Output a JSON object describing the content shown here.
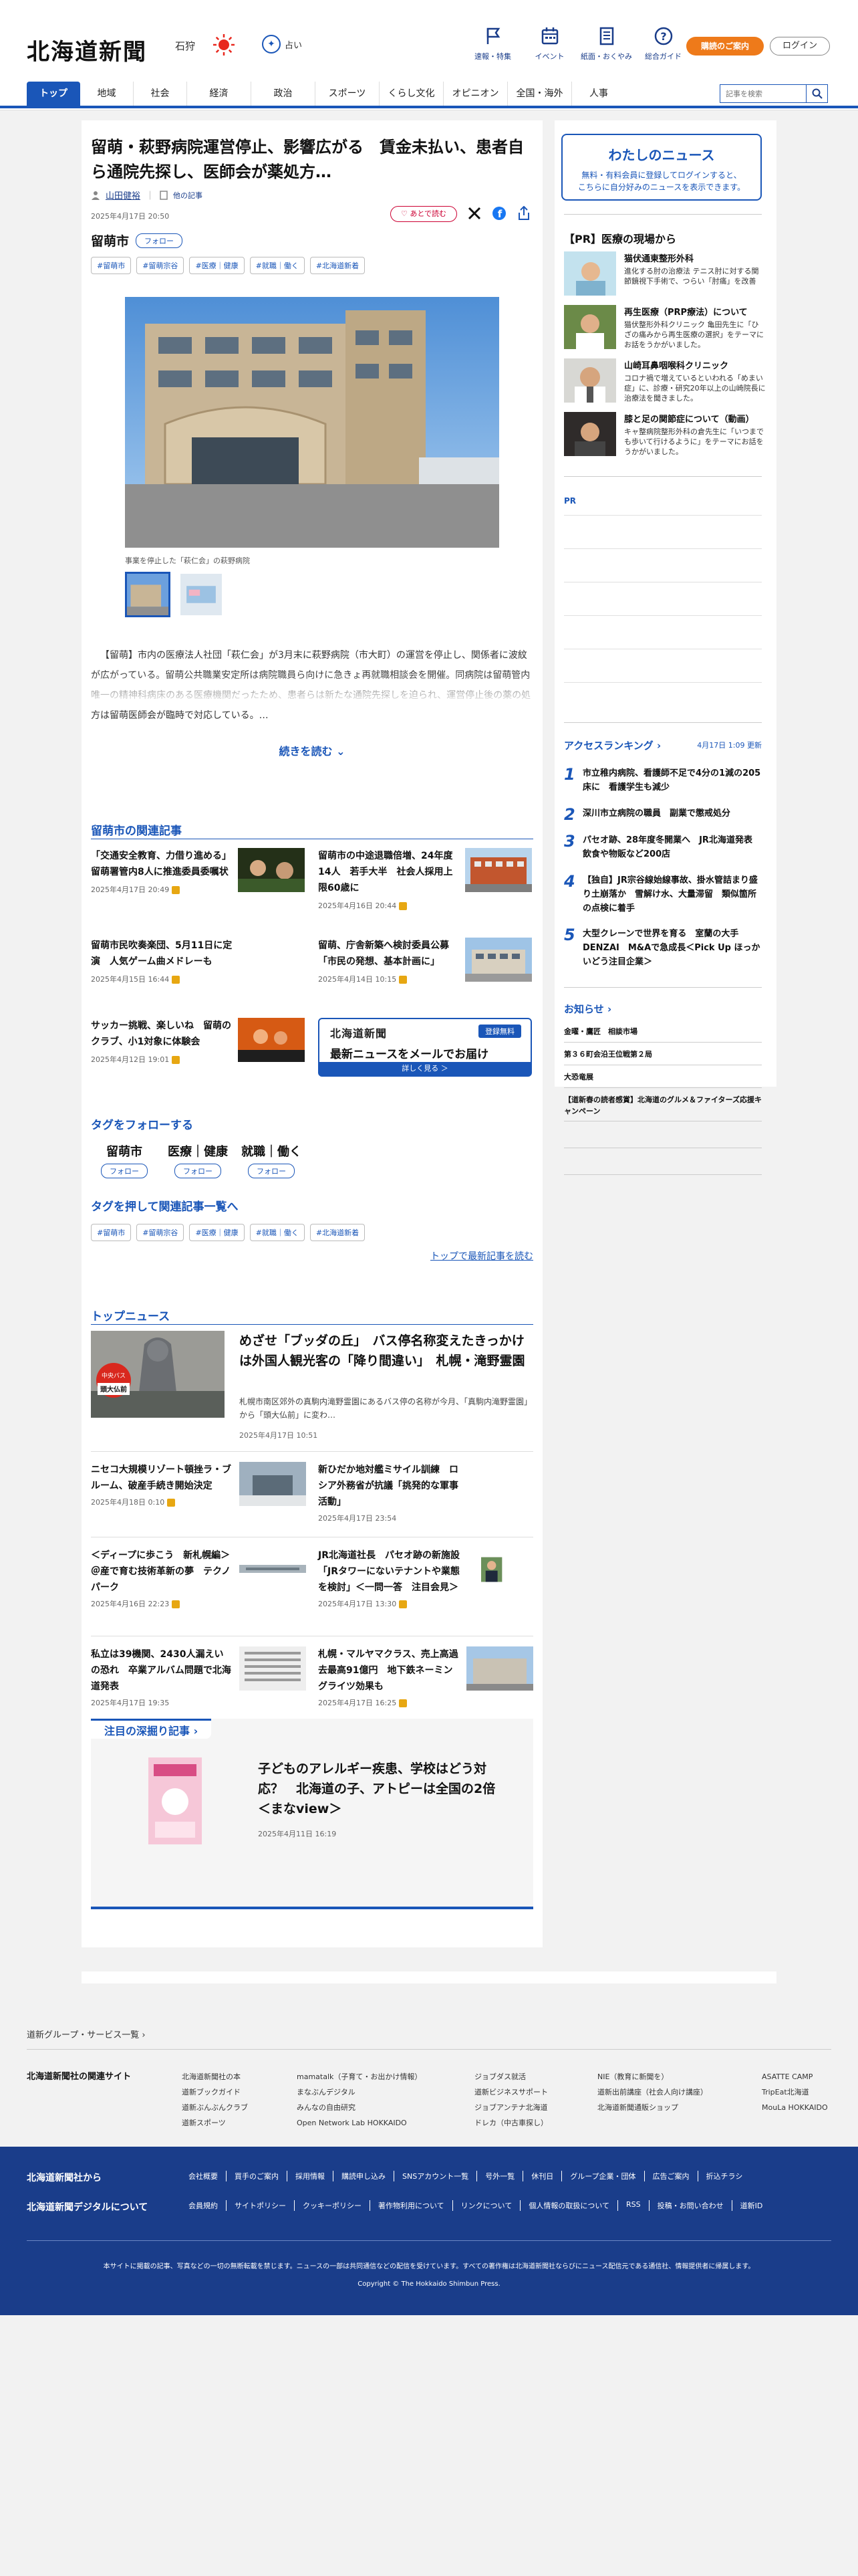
{
  "header": {
    "logo": "北海道新聞",
    "region": "石狩",
    "fortune": "占い",
    "icons": [
      {
        "label": "速報・特集",
        "icon": "flag-icon"
      },
      {
        "label": "イベント",
        "icon": "calendar-icon"
      },
      {
        "label": "紙面・おくやみ",
        "icon": "newspaper-icon"
      },
      {
        "label": "総合ガイド",
        "icon": "help-icon"
      }
    ],
    "join": "購読のご案内",
    "login": "ログイン",
    "search_placeholder": "記事を検索"
  },
  "nav": [
    "トップ",
    "地域",
    "社会",
    "経済",
    "政治",
    "スポーツ",
    "くらし文化",
    "オピニオン",
    "全国・海外",
    "人事"
  ],
  "article": {
    "title": "留萌・萩野病院運営停止、影響広がる　賃金未払い、患者自ら通院先探し、医師会が薬処方…",
    "author": "山田健裕",
    "author_link": "他の記事",
    "date": "2025年4月17日 20:50",
    "favorite": "あとで読む",
    "city": "留萌市",
    "follow": "フォロー",
    "tags": [
      "#留萌市",
      "#留萌宗谷",
      "#医療｜健康",
      "#就職｜働く",
      "#北海道新着"
    ],
    "caption": "事業を停止した「萩仁会」の萩野病院",
    "body": "【留萌】市内の医療法人社団「萩仁会」が3月末に萩野病院（市大町）の運営を停止し、関係者に波紋が広がっている。留萌公共職業安定所は病院職員ら向けに急きょ再就職相談会を開催。同病院は留萌管内唯一の精神科病床のある医療機関だったため、患者らは新たな通院先探しを迫られ、運営停止後の薬の処方は留萌医師会が臨時で対応している。…",
    "read_more": "続きを読む"
  },
  "related": {
    "title": "留萌市の関連記事",
    "items": [
      {
        "title": "「交通安全教育、力借り進める」　留萌署管内8人に推進委員委嘱状",
        "date": "2025年4月17日 20:49"
      },
      {
        "title": "留萌市の中途退職倍増、24年度14人　若手大半　社会人採用上限60歳に",
        "date": "2025年4月16日 20:44"
      },
      {
        "title": "留萌市民吹奏楽団、5月11日に定演　人気ゲーム曲メドレーも",
        "date": "2025年4月15日 16:44"
      },
      {
        "title": "留萌、庁舎新築へ検討委員公募　「市民の発想、基本計画に」",
        "date": "2025年4月14日 10:15"
      },
      {
        "title": "サッカー挑戦、楽しいね　留萌のクラブ、小1対象に体験会",
        "date": "2025年4月12日 19:01"
      }
    ],
    "mail_logo": "北海道新聞",
    "mail_badge": "登録無料",
    "mail_title": "最新ニュースをメールでお届け",
    "mail_more": "詳しく見る ＞"
  },
  "tag_follow": {
    "title": "タグをフォローする",
    "items": [
      "留萌市",
      "医療｜健康",
      "就職｜働く"
    ],
    "follow": "フォロー",
    "list_title": "タグを押して関連記事一覧へ",
    "tags": [
      "#留萌市",
      "#留萌宗谷",
      "#医療｜健康",
      "#就職｜働く",
      "#北海道新着"
    ],
    "latest": "トップで最新記事を読む"
  },
  "top_news": {
    "title": "トップニュース",
    "main": {
      "title": "めざせ「ブッダの丘」　バス停名称変えたきっかけは外国人観光客の「降り間違い」　札幌・滝野霊園",
      "summary": "札幌市南区郊外の真駒内滝野霊園にあるバス停の名称が今月、「真駒内滝野霊園」から「頭大仏前」に変わ…",
      "date": "2025年4月17日 10:51"
    },
    "items": [
      {
        "title": "ニセコ大規模リゾート頓挫ラ・ブルーム、破産手続き開始決定",
        "date": "2025年4月18日 0:10"
      },
      {
        "title": "新ひだか地対艦ミサイル訓練　ロシア外務省が抗議「挑発的な軍事活動」",
        "date": "2025年4月17日 23:54"
      },
      {
        "title": "＜ディープに歩こう　新札幌編＞＠産で育む技術革新の夢　テクノパーク",
        "date": "2025年4月16日 22:23"
      },
      {
        "title": "JR北海道社長　パセオ跡の新施設「JRタワーにないテナントや業態を検討」＜一問一答　注目会見＞",
        "date": "2025年4月17日 13:30"
      },
      {
        "title": "私立は39機関、2430人漏えいの恐れ　卒業アルバム問題で北海道発表",
        "date": "2025年4月17日 19:35"
      },
      {
        "title": "札幌・マルヤマクラス、売上高過去最高91億円　地下鉄ネーミングライツ効果も",
        "date": "2025年4月17日 16:25"
      }
    ]
  },
  "feature": {
    "label": "注目の深掘り記事",
    "title": "子どものアレルギー疾患、学校はどう対応？　北海道の子、アトピーは全国の2倍＜まなview＞",
    "date": "2025年4月11日 16:19"
  },
  "sidebar": {
    "mynews_title": "わたしのニュース",
    "mynews_text1": "無料・有料会員に登録してログインすると、",
    "mynews_text2": "こちらに自分好みのニュースを表示できます。",
    "pr_title": "【PR】医療の現場から",
    "pr_items": [
      {
        "title": "猫伏通東整形外科",
        "text": "進化する肘の治療法 テニス肘に対する関節鏡視下手術で、つらい「肘痛」を改善"
      },
      {
        "title": "再生医療（PRP療法）について",
        "text": "猫伏整形外科クリニック 亀田先生に「ひざの痛みから再生医療の選択」をテーマにお話をうかがいました。"
      },
      {
        "title": "山崎耳鼻咽喉科クリニック",
        "text": "コロナ禍で増えているといわれる「めまい症」に、診療・研究20年以上の山崎院長に治療法を聞きました。"
      },
      {
        "title": "膝と足の関節症について（動画）",
        "text": "キャ整病院整形外科の倉先生に「いつまでも歩いて行けるように」をテーマにお話をうかがいました。"
      }
    ],
    "pr_label": "PR",
    "ranking_title": "アクセスランキング",
    "ranking_time": "4月17日 1:09 更新",
    "ranking": [
      {
        "n": "1",
        "title": "市立稚内病院、看護師不足で4分の1減の205床に　看護学生も減少"
      },
      {
        "n": "2",
        "title": "深川市立病院の職員　副業で懲戒処分"
      },
      {
        "n": "3",
        "title": "パセオ跡、28年度冬開業へ　JR北海道発表　飲食や物販など200店"
      },
      {
        "n": "4",
        "title": "【独自】JR宗谷線始線事故、掛水管詰まり盛り土崩落か　雪解け水、大量滞留　類似箇所の点検に着手"
      },
      {
        "n": "5",
        "title": "大型クレーンで世界を育る　室蘭の大手DENZAI　M&Aで急成長＜Pick Up ほっかいどう注目企業＞"
      }
    ],
    "notice_title": "お知らせ",
    "notices": [
      "金曜・鷹匠　相談市場",
      "第３６町会沿王位戦第２局",
      "大恐竜展",
      "【道新春の読者感賞】北海道のグルメ＆ファイターズ応援キャンペーン"
    ]
  },
  "footer": {
    "group_title": "道新グループ・サービス一覧",
    "site_title": "北海道新聞社の関連サイト",
    "col1": [
      "北海道新聞社の本",
      "道新ブックガイド",
      "道新ぶんぶんクラブ",
      "道新スポーツ"
    ],
    "col2": [
      "mamatalk（子育て・お出かけ情報）",
      "まなぶんデジタル",
      "みんなの自由研究",
      "Open Network Lab HOKKAIDO"
    ],
    "col3": [
      "ジョブダス就活",
      "道新ビジネスサポート",
      "ジョブアンテナ北海道",
      "ドレカ（中古車探し）"
    ],
    "col4": [
      "NIE（教育に新聞を）",
      "道新出前講座（社会人向け講座）",
      "北海道新聞通販ショップ"
    ],
    "col5": [
      "ASATTE CAMP",
      "TripEat北海道",
      "MouLa HOKKAIDO"
    ],
    "about": "北海道新聞社から",
    "digital": "北海道新聞デジタルについて",
    "links1": [
      "会社概要",
      "買手のご案内",
      "採用情報",
      "購読申し込み",
      "SNSアカウント一覧",
      "号外一覧",
      "休刊日",
      "グループ企業・団体",
      "広告ご案内",
      "折込チラシ"
    ],
    "links2": [
      "会員規約",
      "サイトポリシー",
      "クッキーポリシー",
      "著作物利用について",
      "リンクについて",
      "個人情報の取扱について",
      "RSS",
      "投稿・お問い合わせ",
      "道新ID"
    ],
    "note": "本サイトに掲載の記事、写真などの一切の無断転載を禁じます。ニュースの一部は共同通信などの配信を受けています。すべての著作権は北海道新聞社ならびにニュース配信元である通信社、情報提供者に帰属します。",
    "copyright": "Copyright © The Hokkaido Shimbun Press."
  },
  "colors": {
    "brand": "#1a56b8",
    "navy": "#1a3d8a",
    "accent": "#ee7a1a"
  }
}
